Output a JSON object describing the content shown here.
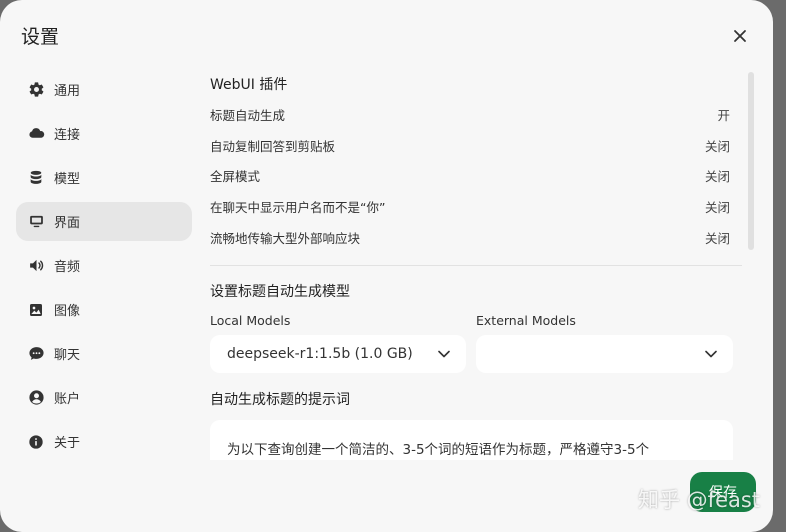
{
  "modal": {
    "title": "设置"
  },
  "sidebar": {
    "items": [
      {
        "label": "通用",
        "icon": "gear-icon"
      },
      {
        "label": "连接",
        "icon": "cloud-icon"
      },
      {
        "label": "模型",
        "icon": "database-icon"
      },
      {
        "label": "界面",
        "icon": "monitor-icon",
        "active": true
      },
      {
        "label": "音频",
        "icon": "speaker-icon"
      },
      {
        "label": "图像",
        "icon": "image-icon"
      },
      {
        "label": "聊天",
        "icon": "chat-icon"
      },
      {
        "label": "账户",
        "icon": "user-icon"
      },
      {
        "label": "关于",
        "icon": "info-icon"
      }
    ]
  },
  "webui": {
    "title": "WebUI 插件",
    "settings": [
      {
        "label": "标题自动生成",
        "value": "开"
      },
      {
        "label": "自动复制回答到剪贴板",
        "value": "关闭"
      },
      {
        "label": "全屏模式",
        "value": "关闭"
      },
      {
        "label": "在聊天中显示用户名而不是“你”",
        "value": "关闭"
      },
      {
        "label": "流畅地传输大型外部响应块",
        "value": "关闭"
      }
    ]
  },
  "title_model": {
    "title": "设置标题自动生成模型",
    "local_label": "Local Models",
    "local_value": "deepseek-r1:1.5b (1.0 GB)",
    "external_label": "External Models",
    "external_value": ""
  },
  "prompt": {
    "title": "自动生成标题的提示词",
    "text": "为以下查询创建一个简洁的、3-5个词的短语作为标题，严格遵守3-5个"
  },
  "footer": {
    "save_label": "保存"
  },
  "watermark": "知乎 @feast",
  "colors": {
    "accent": "#188046",
    "modal_bg": "#f7f7f7",
    "backdrop": "#6b6b6b"
  }
}
